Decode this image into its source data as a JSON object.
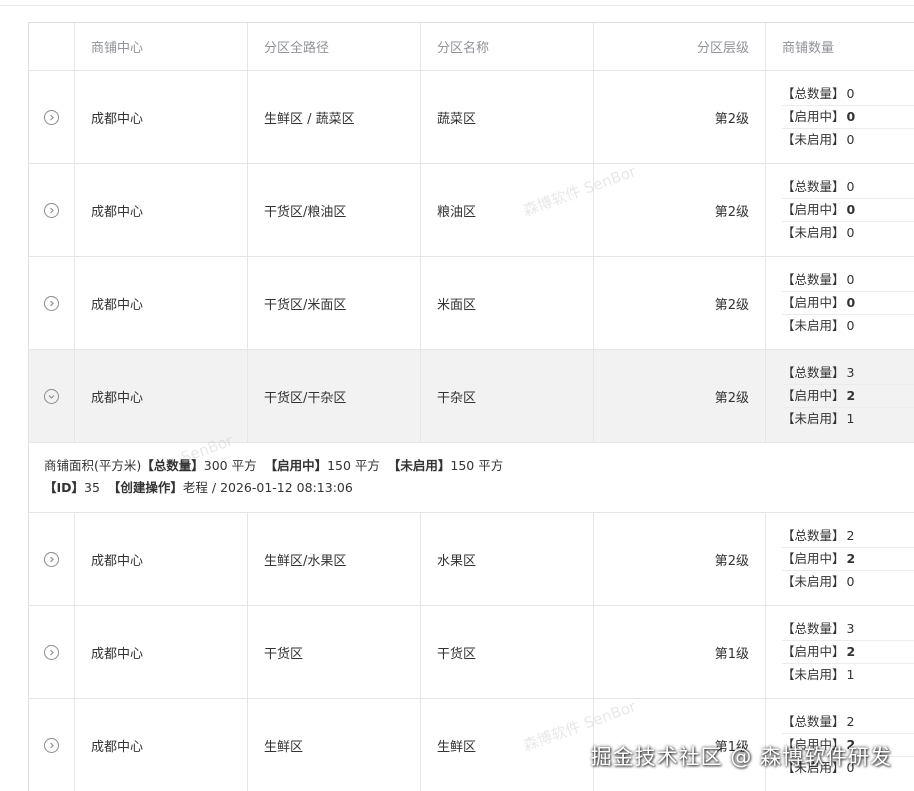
{
  "table": {
    "headers": {
      "center": "商铺中心",
      "path": "分区全路径",
      "name": "分区名称",
      "level": "分区层级",
      "count": "商铺数量"
    },
    "count_labels": {
      "total": "【总数量】",
      "enabled": "【启用中】",
      "disabled": "【未启用】"
    },
    "rows": [
      {
        "center": "成都中心",
        "path": "生鲜区 / 蔬菜区",
        "name": "蔬菜区",
        "level": "第2级",
        "total": "0",
        "enabled": "0",
        "disabled": "0",
        "expanded": false
      },
      {
        "center": "成都中心",
        "path": "干货区/粮油区",
        "name": "粮油区",
        "level": "第2级",
        "total": "0",
        "enabled": "0",
        "disabled": "0",
        "expanded": false
      },
      {
        "center": "成都中心",
        "path": "干货区/米面区",
        "name": "米面区",
        "level": "第2级",
        "total": "0",
        "enabled": "0",
        "disabled": "0",
        "expanded": false
      },
      {
        "center": "成都中心",
        "path": "干货区/干杂区",
        "name": "干杂区",
        "level": "第2级",
        "total": "3",
        "enabled": "2",
        "disabled": "1",
        "expanded": true
      },
      {
        "center": "成都中心",
        "path": "生鲜区/水果区",
        "name": "水果区",
        "level": "第2级",
        "total": "2",
        "enabled": "2",
        "disabled": "0",
        "expanded": false
      },
      {
        "center": "成都中心",
        "path": "干货区",
        "name": "干货区",
        "level": "第1级",
        "total": "3",
        "enabled": "2",
        "disabled": "1",
        "expanded": false
      },
      {
        "center": "成都中心",
        "path": "生鲜区",
        "name": "生鲜区",
        "level": "第1级",
        "total": "2",
        "enabled": "2",
        "disabled": "0",
        "expanded": false
      }
    ]
  },
  "detail": {
    "area_prefix": "商铺面积(平方米)",
    "total_label": "【总数量】",
    "total_value": "300 平方",
    "enabled_label": "【启用中】",
    "enabled_value": "150 平方",
    "disabled_label": "【未启用】",
    "disabled_value": "150 平方",
    "id_label": "【ID】",
    "id_value": "35",
    "creator_label": "【创建操作】",
    "creator_value": "老程 / 2026-01-12 08:13:06"
  },
  "watermark": {
    "text": "森博软件 SenBor",
    "short": "SenBor"
  },
  "community_mark": "掘金技术社区 @ 森博软件研发",
  "icons": {
    "collapsed": "chevron-right-circle-icon",
    "expanded": "chevron-down-circle-icon"
  },
  "colors": {
    "header_text": "#909399",
    "expanded_row_bg": "#f2f2f2",
    "border": "#e6e6e6"
  }
}
